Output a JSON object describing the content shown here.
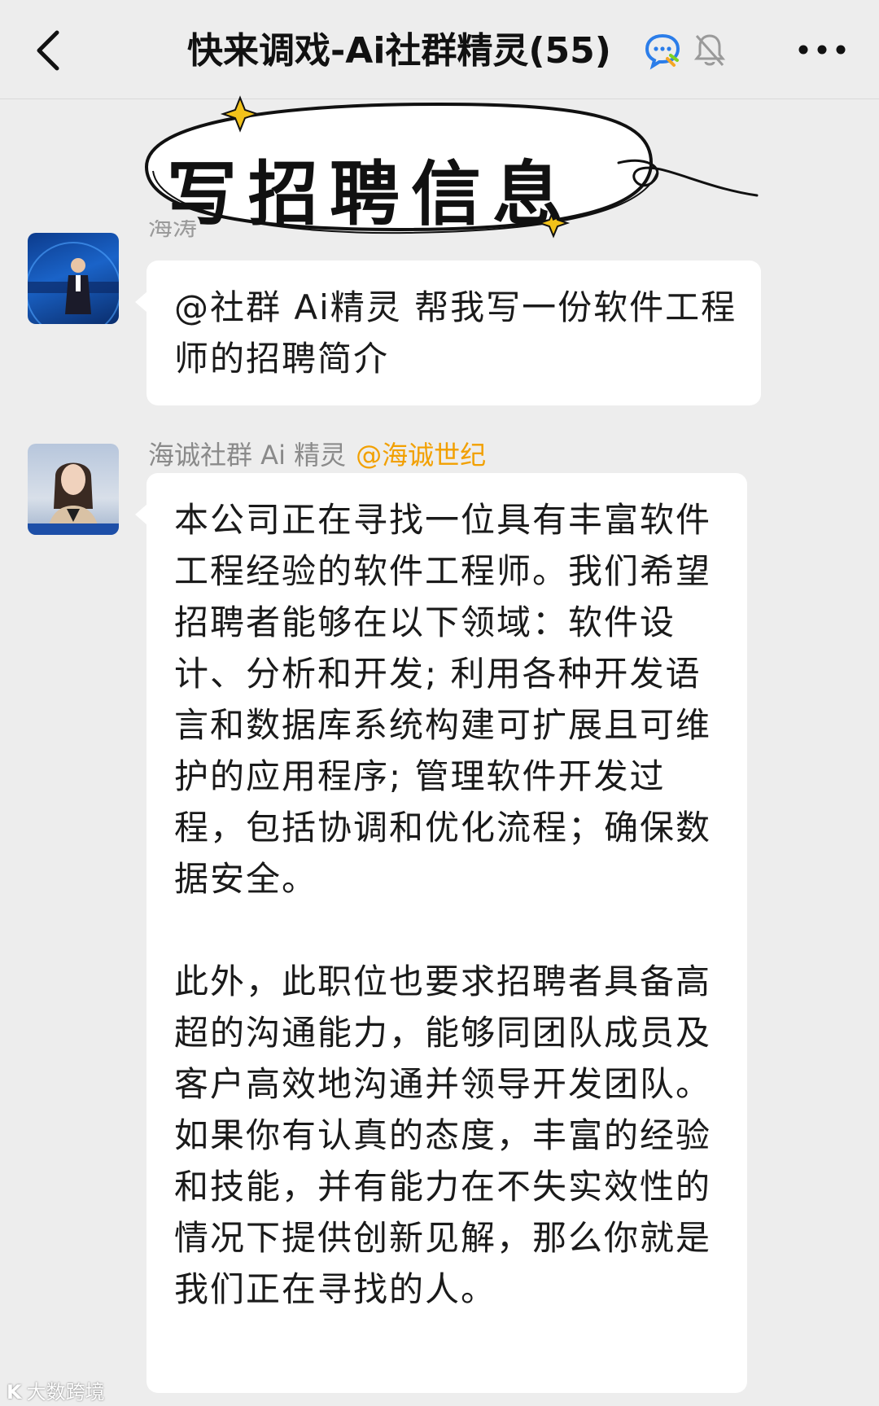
{
  "header": {
    "title": "快来调戏-Ai社群精灵(55)",
    "icons": [
      "back-chevron-icon",
      "chat-bubble-icon",
      "mute-bell-icon",
      "more-dots-icon"
    ]
  },
  "banner": {
    "text": "写招聘信息"
  },
  "messages": [
    {
      "sender": "海涛",
      "text": "@社群 Ai精灵 帮我写一份软件工程师的招聘简介"
    },
    {
      "sender": "海诚社群 Ai 精灵",
      "mention": "@海诚世纪",
      "paragraphs": [
        "本公司正在寻找一位具有丰富软件工程经验的软件工程师。我们希望招聘者能够在以下领域：软件设计、分析和开发; 利用各种开发语言和数据库系统构建可扩展且可维护的应用程序; 管理软件开发过程，包括协调和优化流程；确保数据安全。",
        "此外，此职位也要求招聘者具备高超的沟通能力，能够同团队成员及客户高效地沟通并领导开发团队。如果你有认真的态度，丰富的经验和技能，并有能力在不失实效性的情况下提供创新见解，那么你就是我们正在寻找的人。"
      ]
    }
  ],
  "watermark": {
    "logo": "K",
    "text": "大数跨境"
  },
  "colors": {
    "background": "#ededed",
    "bubble": "#ffffff",
    "mention": "#f2a000",
    "sender": "#8a8a8a"
  }
}
